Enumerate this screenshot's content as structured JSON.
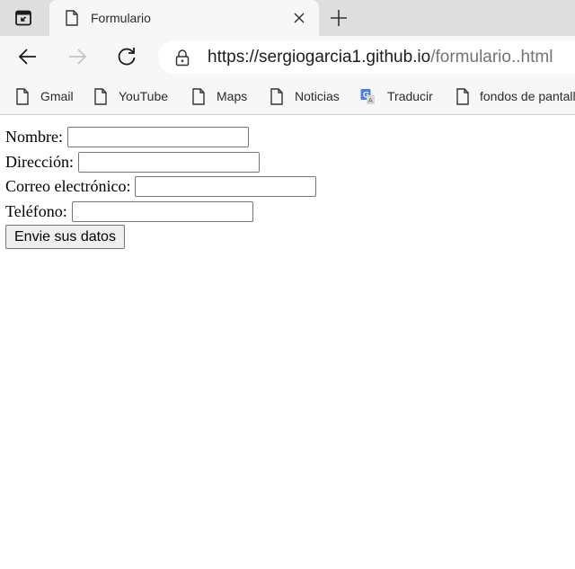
{
  "tab": {
    "title": "Formulario"
  },
  "toolbar": {
    "url_base": "https://sergiogarcia1.github.io",
    "url_path": "/formulario..html"
  },
  "bookmarks": [
    {
      "label": "Gmail",
      "icon": "page-icon"
    },
    {
      "label": "YouTube",
      "icon": "page-icon"
    },
    {
      "label": "Maps",
      "icon": "page-icon"
    },
    {
      "label": "Noticias",
      "icon": "page-icon"
    },
    {
      "label": "Traducir",
      "icon": "translate-icon"
    },
    {
      "label": "fondos de pantalla",
      "icon": "page-icon"
    }
  ],
  "form": {
    "nombre_label": "Nombre:",
    "direccion_label": "Dirección:",
    "correo_label": "Correo electrónico:",
    "telefono_label": "Teléfono:",
    "nombre_value": "",
    "direccion_value": "",
    "correo_value": "",
    "telefono_value": "",
    "submit_label": "Envie sus datos"
  },
  "colors": {
    "tabstrip_bg": "#dedede",
    "toolbar_bg": "#f7f7f7",
    "url_path_color": "#737373",
    "translate_blue": "#4a7fe8"
  }
}
